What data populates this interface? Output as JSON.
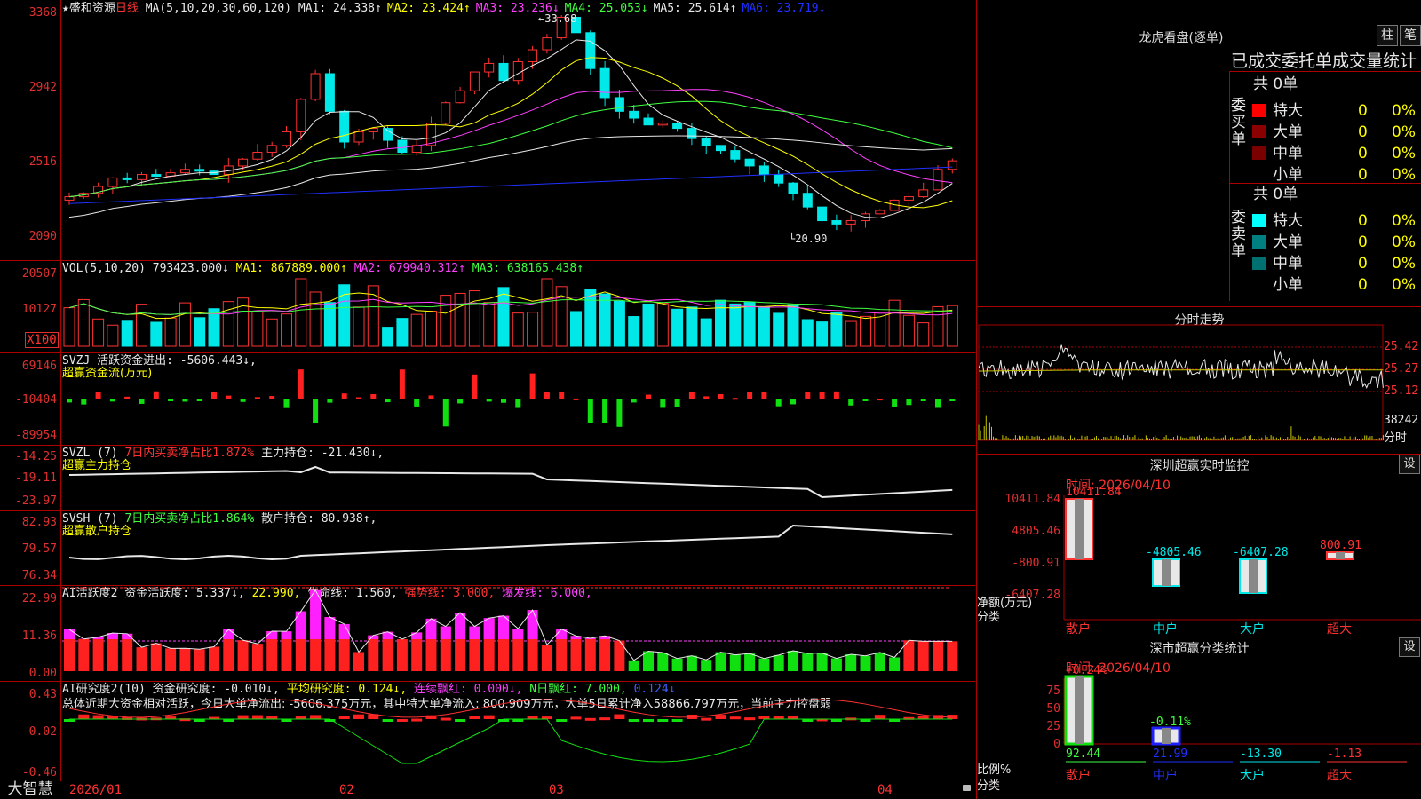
{
  "stock": {
    "name": "盛和资源",
    "star": "★",
    "period": "日线",
    "ma_label": "MA(5,10,20,30,60,120)",
    "ma": [
      {
        "label": "MA1: 24.338",
        "arrow": "↑",
        "color": "#e8e8e8"
      },
      {
        "label": "MA2: 23.424",
        "arrow": "↑",
        "color": "#ffff00"
      },
      {
        "label": "MA3: 23.236",
        "arrow": "↓",
        "color": "#ff40ff"
      },
      {
        "label": "MA4: 25.053",
        "arrow": "↓",
        "color": "#40ff40"
      },
      {
        "label": "MA5: 25.614",
        "arrow": "↑",
        "color": "#e8e8e8"
      },
      {
        "label": "MA6: 23.719",
        "arrow": "↓",
        "color": "#2030ff"
      }
    ],
    "price_axis": [
      "3368",
      "2942",
      "2516",
      "2090"
    ],
    "high_label": "33.68",
    "low_label": "20.90"
  },
  "vol": {
    "header": "VOL(5,10,20)",
    "value": "793423.000↓",
    "ma1": "MA1: 867889.000↑",
    "ma2": "MA2: 679940.312↑",
    "ma3": "MA3: 638165.438↑",
    "axis": [
      "20507",
      "10127"
    ],
    "unit": "X100"
  },
  "svzj": {
    "header": "SVZJ  活跃资金进出: -5606.443↓,",
    "sub": "超赢资金流(万元)",
    "axis": [
      "69146",
      "-10404",
      "-89954"
    ]
  },
  "svzl": {
    "header_a": "SVZL (7)",
    "header_b": "7日内买卖净占比1.872%",
    "header_c": "主力持仓: -21.430↓,",
    "sub": "超赢主力持仓",
    "axis": [
      "-14.25",
      "-19.11",
      "-23.97"
    ]
  },
  "svsh": {
    "header_a": "SVSH (7)",
    "header_b": "7日内买卖净占比1.864%",
    "header_c": "散户持仓: 80.938↑,",
    "sub": "超赢散户持仓",
    "axis": [
      "82.93",
      "79.57",
      "76.34"
    ]
  },
  "ai1": {
    "h1": "AI活跃度2 资金活跃度: 5.337↓,",
    "h2": "22.990,",
    "h3": "生命线: 1.560,",
    "h4": "强势线: 3.000,",
    "h5": "爆发线: 6.000,",
    "axis": [
      "22.99",
      "11.36",
      "0.00"
    ]
  },
  "ai2": {
    "h1": "AI研究度2(10) 资金研究度: -0.010↓,",
    "h2": "平均研究度: 0.124↓,",
    "h3": "连续飘红: 0.000↓,",
    "h4": "N日飘红: 7.000,",
    "h5": "0.124↓",
    "summary": "总体近期大资金相对活跃，今日大单净流出: -5606.375万元，其中特大单净流入: 800.909万元，大单5日累计净入58866.797万元，当前主力控盘弱",
    "axis": [
      "0.43",
      "-0.02",
      "-0.46"
    ]
  },
  "xaxis": [
    "2026/01",
    "02",
    "03",
    "04"
  ],
  "bottom_tab": "大智慧",
  "lhb": {
    "title": "龙虎看盘(逐单)",
    "btn_a": "柱",
    "btn_b": "笔",
    "subtitle": "已成交委托单成交量统计",
    "buy_label": "委买单",
    "sell_label": "委卖单",
    "buy_total": "共 0单",
    "sell_total": "共 0单",
    "rows": [
      "特大",
      "大单",
      "中单",
      "小单"
    ],
    "zero": "0",
    "pct": "0%"
  },
  "intraday": {
    "title": "分时走势",
    "axis": [
      "25.42",
      "25.27",
      "25.12"
    ],
    "vol_label": "38242",
    "vol_unit": "分时"
  },
  "sz_monitor": {
    "title": "深圳超赢实时监控",
    "btn": "设",
    "time": "时间: 2026/04/10",
    "axis": [
      "10411.84",
      "4805.46",
      "-800.91",
      "-6407.28"
    ],
    "net_label": "净额(万元)",
    "cat_label": "分类",
    "bars": [
      {
        "label": "散户",
        "value": "10411.84"
      },
      {
        "label": "中户",
        "value": "-4805.46"
      },
      {
        "label": "大户",
        "value": "-6407.28"
      },
      {
        "label": "超大",
        "value": "800.91"
      }
    ]
  },
  "sz_class": {
    "title": "深市超赢分类统计",
    "btn": "设",
    "time": "时间: 2026/04/10",
    "axis": [
      "75",
      "50",
      "25",
      "0"
    ],
    "pct_label": "比例%",
    "cat_label": "分类",
    "top_labels": [
      "+0.24%",
      "-0.11%"
    ],
    "values": [
      "92.44",
      "21.99",
      "-13.30",
      "-1.13"
    ],
    "cats": [
      "散户",
      "中户",
      "大户",
      "超大"
    ]
  }
}
